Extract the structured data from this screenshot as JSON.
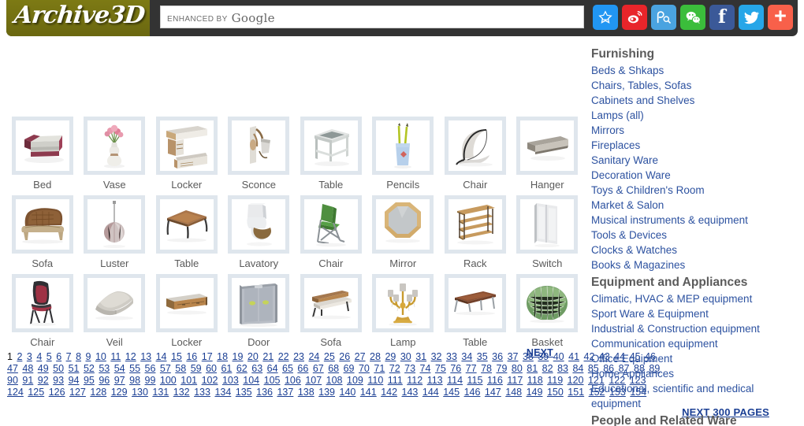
{
  "header": {
    "logo_text": "Archive3D",
    "search": {
      "value": "",
      "placeholder": "",
      "enhanced_by": "ENHANCED BY",
      "google": "Google"
    },
    "social": [
      {
        "name": "qzone-share-icon",
        "title": "QZone",
        "color": "#2196f3"
      },
      {
        "name": "weibo-share-icon",
        "title": "Weibo",
        "color": "#e8252a"
      },
      {
        "name": "baidu-share-icon",
        "title": "Baidu",
        "color": "#4aa3e0"
      },
      {
        "name": "wechat-share-icon",
        "title": "WeChat",
        "color": "#3bbd3b"
      },
      {
        "name": "facebook-share-icon",
        "title": "Facebook",
        "color": "#3b5998"
      },
      {
        "name": "twitter-share-icon",
        "title": "Twitter",
        "color": "#26a6e8"
      },
      {
        "name": "more-share-icon",
        "title": "More",
        "color": "#f8604a"
      }
    ]
  },
  "grid": {
    "rows": [
      [
        {
          "label": "Bed",
          "icon": "bed"
        },
        {
          "label": "Vase",
          "icon": "vase"
        },
        {
          "label": "Locker",
          "icon": "locker-wall"
        },
        {
          "label": "Sconce",
          "icon": "sconce"
        },
        {
          "label": "Table",
          "icon": "table-side"
        },
        {
          "label": "Pencils",
          "icon": "pencils"
        },
        {
          "label": "Chair",
          "icon": "chair-lounge"
        },
        {
          "label": "Hanger",
          "icon": "hanger-shelf"
        }
      ],
      [
        {
          "label": "Sofa",
          "icon": "sofa-classic"
        },
        {
          "label": "Luster",
          "icon": "luster"
        },
        {
          "label": "Table",
          "icon": "table-coffee"
        },
        {
          "label": "Lavatory",
          "icon": "lavatory"
        },
        {
          "label": "Chair",
          "icon": "chair-folding"
        },
        {
          "label": "Mirror",
          "icon": "mirror-octagon"
        },
        {
          "label": "Rack",
          "icon": "rack-shelf"
        },
        {
          "label": "Switch",
          "icon": "switch-plate"
        }
      ],
      [
        {
          "label": "Chair",
          "icon": "chair-red"
        },
        {
          "label": "Veil",
          "icon": "veil"
        },
        {
          "label": "Locker",
          "icon": "locker-low"
        },
        {
          "label": "Door",
          "icon": "door-double"
        },
        {
          "label": "Sofa",
          "icon": "sofa-bench"
        },
        {
          "label": "Lamp",
          "icon": "lamp-candelabra"
        },
        {
          "label": "Table",
          "icon": "table-long"
        },
        {
          "label": "Basket",
          "icon": "basket-green"
        }
      ]
    ]
  },
  "pager": {
    "current_page": 1,
    "next_label": "NEXT",
    "next_300_label": "NEXT 300 PAGES",
    "lines": [
      [
        1,
        2,
        3,
        4,
        5,
        6,
        7,
        8,
        9,
        10,
        11,
        12,
        13,
        14,
        15,
        16,
        17,
        18,
        19,
        20,
        21,
        22,
        23,
        24,
        25,
        26,
        27,
        28,
        29,
        30,
        31,
        32,
        33,
        34,
        35,
        36,
        37,
        38,
        39,
        40,
        41,
        42,
        43,
        44,
        45,
        46
      ],
      [
        47,
        48,
        49,
        50,
        51,
        52,
        53,
        54,
        55,
        56,
        57,
        58,
        59,
        60,
        61,
        62,
        63,
        64,
        65,
        66,
        67,
        68,
        69,
        70,
        71,
        72,
        73,
        74,
        75,
        76,
        77,
        78,
        79,
        80,
        81,
        82,
        83,
        84,
        85,
        86,
        87,
        88,
        89
      ],
      [
        90,
        91,
        92,
        93,
        94,
        95,
        96,
        97,
        98,
        99,
        100,
        101,
        102,
        103,
        104,
        105,
        106,
        107,
        108,
        109,
        110,
        111,
        112,
        113,
        114,
        115,
        116,
        117,
        118,
        119,
        120,
        121,
        122,
        123
      ],
      [
        124,
        125,
        126,
        127,
        128,
        129,
        130,
        131,
        132,
        133,
        134,
        135,
        136,
        137,
        138,
        139,
        140,
        141,
        142,
        143,
        144,
        145,
        146,
        147,
        148,
        149,
        150,
        151,
        152,
        153,
        154
      ]
    ]
  },
  "sidebar": {
    "sections": [
      {
        "heading": "Furnishing",
        "links": [
          "Beds & Shkaps",
          "Chairs, Tables, Sofas",
          "Cabinets and Shelves",
          "Lamps (all)",
          "Mirrors",
          "Fireplaces",
          "Sanitary Ware",
          "Decoration Ware",
          "Toys & Children's Room",
          "Market & Salon",
          "Musical instruments & equipment",
          "Tools & Devices",
          "Clocks & Watches",
          "Books & Magazines"
        ]
      },
      {
        "heading": "Equipment and Appliances",
        "links": [
          "Climatic, HVAC & MEP equipment",
          "Sport Ware & Equipment",
          "Industrial & Construction equipment",
          "Communication equipment",
          "Office Equipment",
          "Home Appliances",
          "Educational, scientific and medical equipment"
        ]
      },
      {
        "heading": "People and Related Ware",
        "links": []
      }
    ]
  },
  "colors": {
    "logo_plate": "#6e6b10",
    "header_bar": "#333333",
    "link_blue": "#2d52a0",
    "pager_blue": "#1b3f94",
    "thumb_frame": "#dfe6ed",
    "heading_gray": "#5b5b5b"
  }
}
